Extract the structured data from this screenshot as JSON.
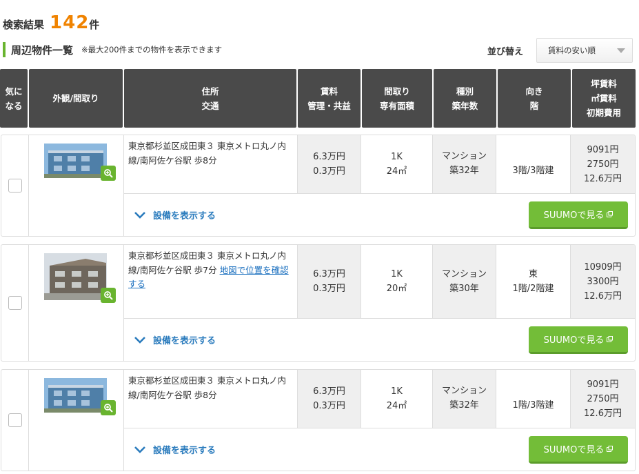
{
  "results": {
    "label": "検索結果",
    "count": "142",
    "unit": "件"
  },
  "section": {
    "title": "周辺物件一覧",
    "note": "※最大200件までの物件を表示できます"
  },
  "sort": {
    "label": "並び替え",
    "value": "賃料の安い順"
  },
  "columns": {
    "fav": [
      "気に",
      "なる"
    ],
    "photo": [
      "外観/間取り"
    ],
    "address": [
      "住所",
      "交通"
    ],
    "rent": [
      "賃料",
      "管理・共益"
    ],
    "layout": [
      "間取り",
      "専有面積"
    ],
    "type": [
      "種別",
      "築年数"
    ],
    "direction": [
      "向き",
      "階"
    ],
    "cost": [
      "坪賃料",
      "㎡賃料",
      "初期費用"
    ]
  },
  "listings": [
    {
      "address": "東京都杉並区成田東３",
      "access": "東京メトロ丸ノ内線/南阿佐ケ谷駅 歩8分",
      "map_link": "",
      "rent": "6.3万円",
      "fee": "0.3万円",
      "madori": "1K",
      "area": "24㎡",
      "kind": "マンション",
      "age": "築32年",
      "direction": "",
      "floor": "3階/3階建",
      "tsubo": "9091円",
      "sqm": "2750円",
      "initial": "12.6万円",
      "equip_label": "設備を表示する",
      "suumo_label": "SUUMOで見る"
    },
    {
      "address": "東京都杉並区成田東３",
      "access": "東京メトロ丸ノ内線/南阿佐ケ谷駅 歩7分",
      "map_link": "地図で位置を確認する",
      "rent": "6.3万円",
      "fee": "0.3万円",
      "madori": "1K",
      "area": "20㎡",
      "kind": "マンション",
      "age": "築30年",
      "direction": "東",
      "floor": "1階/2階建",
      "tsubo": "10909円",
      "sqm": "3300円",
      "initial": "12.6万円",
      "equip_label": "設備を表示する",
      "suumo_label": "SUUMOで見る"
    },
    {
      "address": "東京都杉並区成田東３",
      "access": "東京メトロ丸ノ内線/南阿佐ケ谷駅 歩8分",
      "map_link": "",
      "rent": "6.3万円",
      "fee": "0.3万円",
      "madori": "1K",
      "area": "24㎡",
      "kind": "マンション",
      "age": "築32年",
      "direction": "",
      "floor": "1階/3階建",
      "tsubo": "9091円",
      "sqm": "2750円",
      "initial": "12.6万円",
      "equip_label": "設備を表示する",
      "suumo_label": "SUUMOで見る"
    }
  ],
  "colors": {
    "accent": "#f08300",
    "green": "#73bd38",
    "link": "#1a6fbf",
    "header_bg": "#4a4a4a"
  }
}
